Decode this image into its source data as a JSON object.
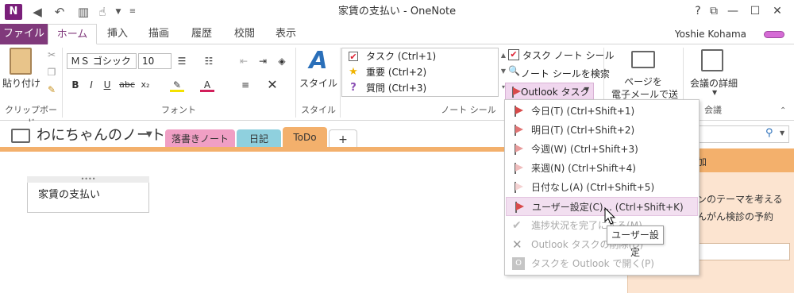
{
  "window": {
    "title": "家賃の支払い - OneNote",
    "app_logo": "N"
  },
  "ribbon_tabs": {
    "file": "ファイル",
    "home": "ホーム",
    "insert": "挿入",
    "draw": "描画",
    "history": "履歴",
    "review": "校閲",
    "view": "表示"
  },
  "user": {
    "name": "Yoshie Kohama"
  },
  "clipboard": {
    "paste": "貼り付け",
    "group": "クリップボード"
  },
  "font": {
    "family": "ＭＳ ゴシック",
    "size": "10",
    "group": "フォント",
    "bold": "B",
    "italic": "I",
    "underline": "U",
    "strike": "abc",
    "subscript": "x₂",
    "font_color": "A"
  },
  "styles": {
    "label": "スタイル",
    "group": "スタイル"
  },
  "tags": {
    "items": [
      "タスク (Ctrl+1)",
      "重要 (Ctrl+2)",
      "質問 (Ctrl+3)"
    ],
    "todo_tag": "タスク ノート シール",
    "find_tags": "ノート シールを検索",
    "outlook_tasks": "Outlook タスク",
    "group": "ノート シール"
  },
  "email": {
    "label1": "ページを",
    "label2": "電子メールで送信"
  },
  "meetings": {
    "label": "会議の詳細",
    "group": "会議"
  },
  "notebook": {
    "name": "わにちゃんのノート"
  },
  "sections": [
    "落書きノート",
    "日記",
    "ToDo",
    "+"
  ],
  "page": {
    "note_text": "家賃の支払い"
  },
  "right_pane": {
    "header_suffix": "加",
    "line1": "ンのテーマを考える",
    "line2": "んがん検診の予約"
  },
  "menu": {
    "items": [
      {
        "label": "今日(T)  (Ctrl+Shift+1)",
        "state": "enabled"
      },
      {
        "label": "明日(T)  (Ctrl+Shift+2)",
        "state": "enabled"
      },
      {
        "label": "今週(W)  (Ctrl+Shift+3)",
        "state": "enabled"
      },
      {
        "label": "来週(N)  (Ctrl+Shift+4)",
        "state": "enabled"
      },
      {
        "label": "日付なし(A)  (Ctrl+Shift+5)",
        "state": "enabled"
      },
      {
        "label": "ユーザー設定(C)...  (Ctrl+Shift+K)",
        "state": "highlighted"
      },
      {
        "label": "進捗状況を完了にする(M)",
        "state": "disabled"
      },
      {
        "label": "Outlook タスクの削除(D)",
        "state": "disabled"
      },
      {
        "label": "タスクを Outlook で開く(P)",
        "state": "disabled"
      }
    ],
    "tooltip": "ユーザー設定"
  },
  "colors": {
    "accent": "#80397b",
    "section_todo": "#f3b06c",
    "section_draft": "#f09fc4",
    "section_diary": "#8fd0de",
    "flag": "#d84a4a"
  }
}
